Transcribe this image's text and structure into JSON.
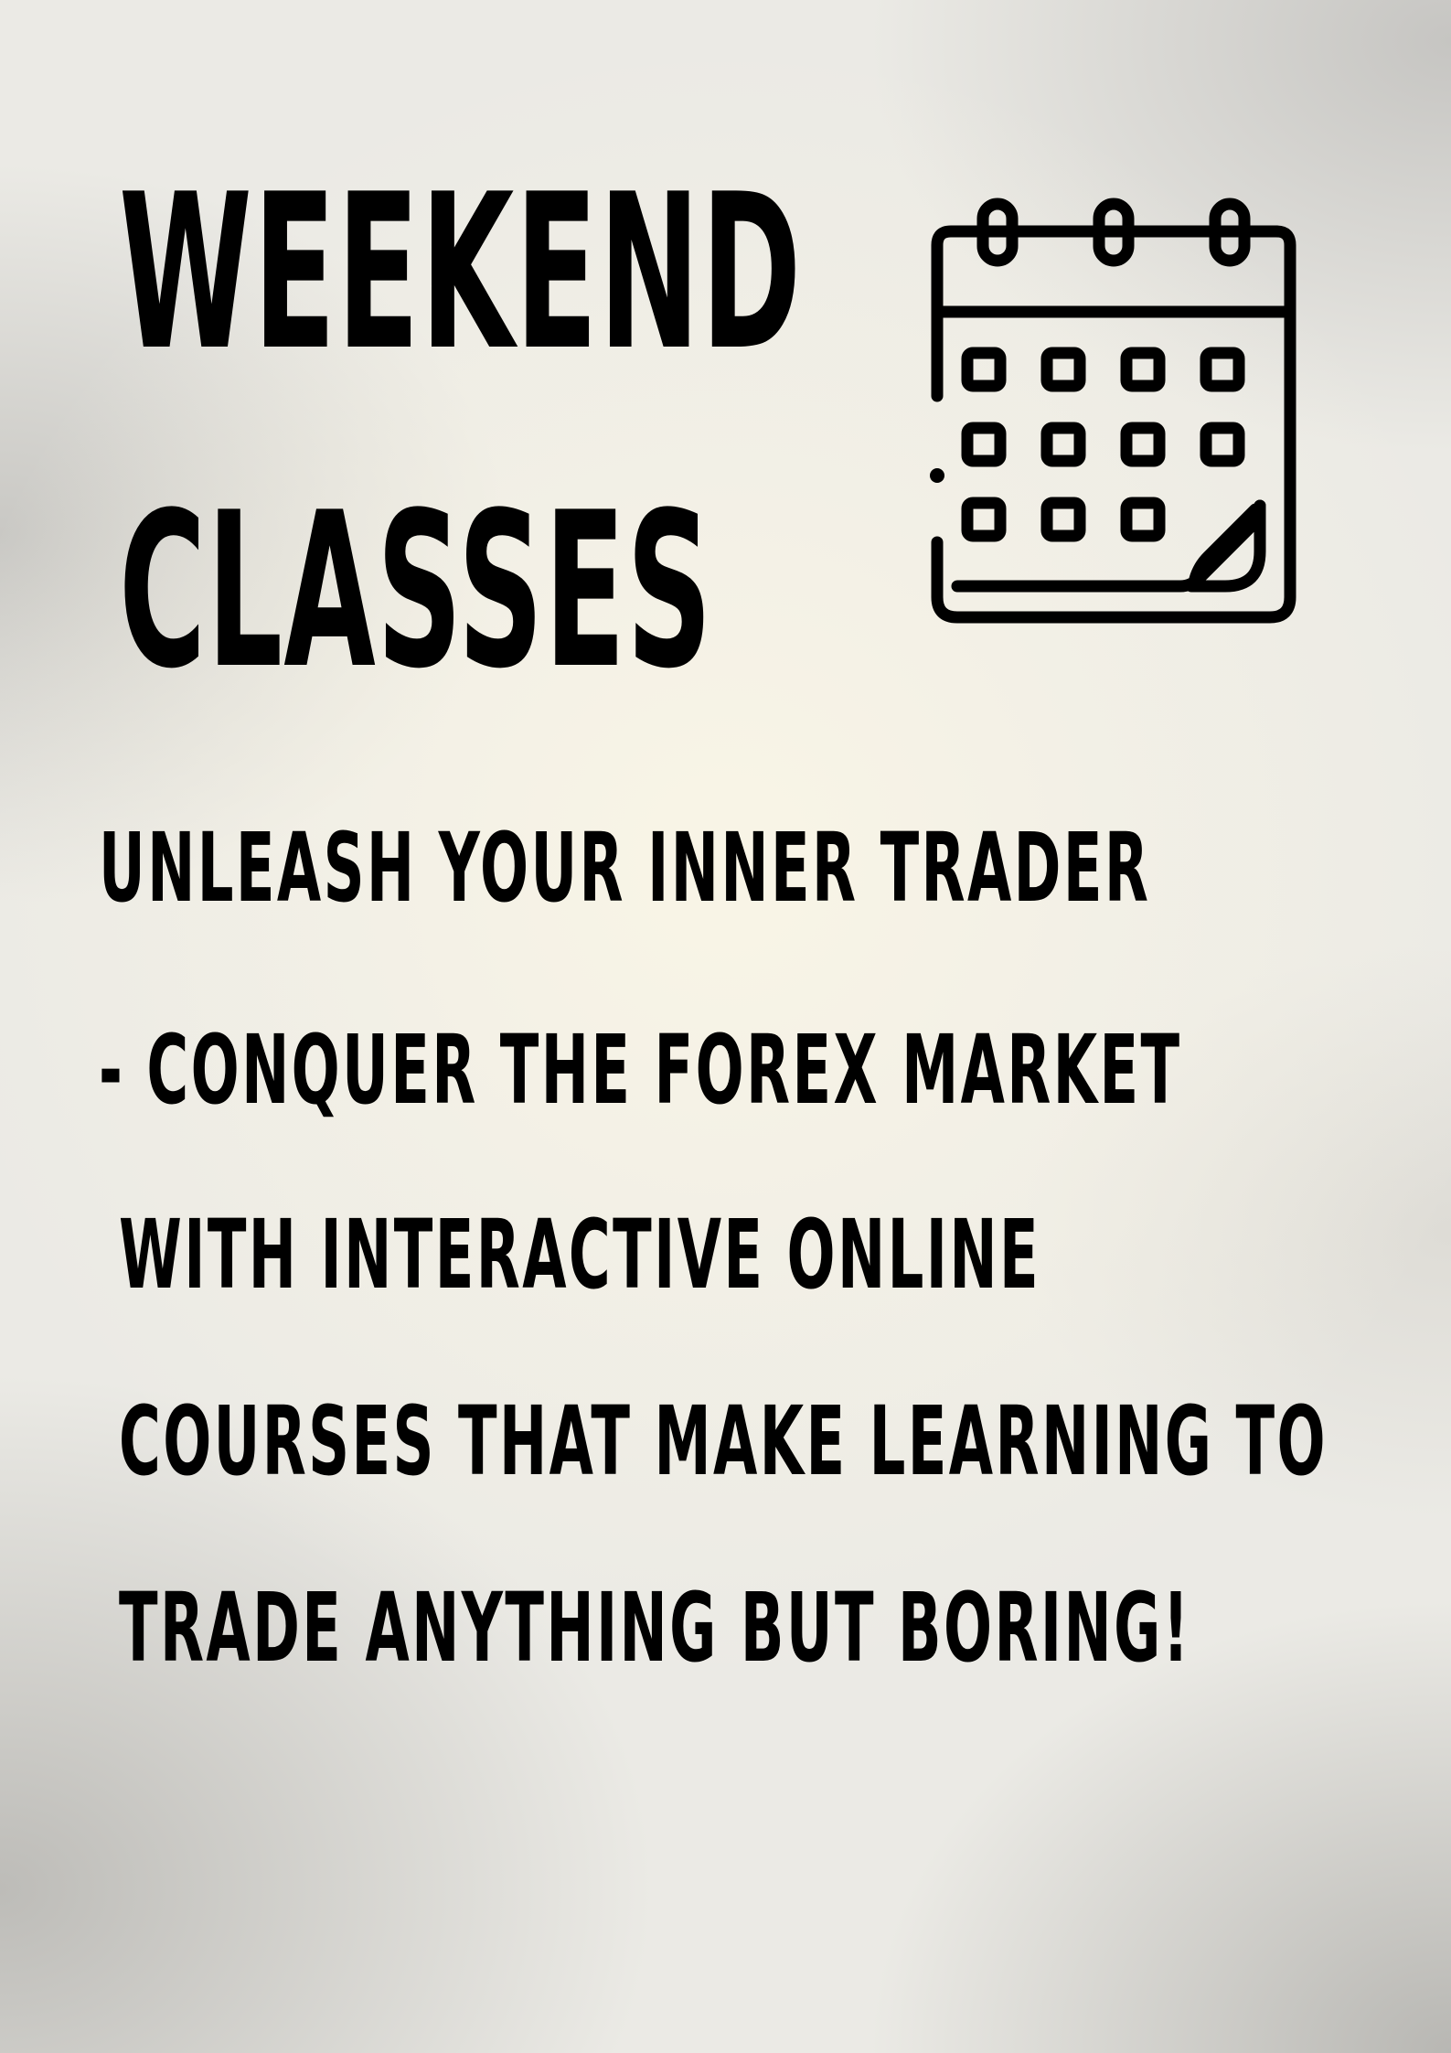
{
  "headline": {
    "line1": "WEEKEND",
    "line2": "CLASSES"
  },
  "icon": "calendar-icon",
  "body": {
    "lines": [
      "UNLEASH YOUR INNER TRADER",
      "- CONQUER THE FOREX MARKET",
      "WITH INTERACTIVE ONLINE",
      "COURSES THAT MAKE LEARNING TO",
      "TRADE ANYTHING BUT BORING!"
    ]
  },
  "colors": {
    "text": "#000000",
    "background": "#ebeae5",
    "glow": "#f9f5e6"
  }
}
